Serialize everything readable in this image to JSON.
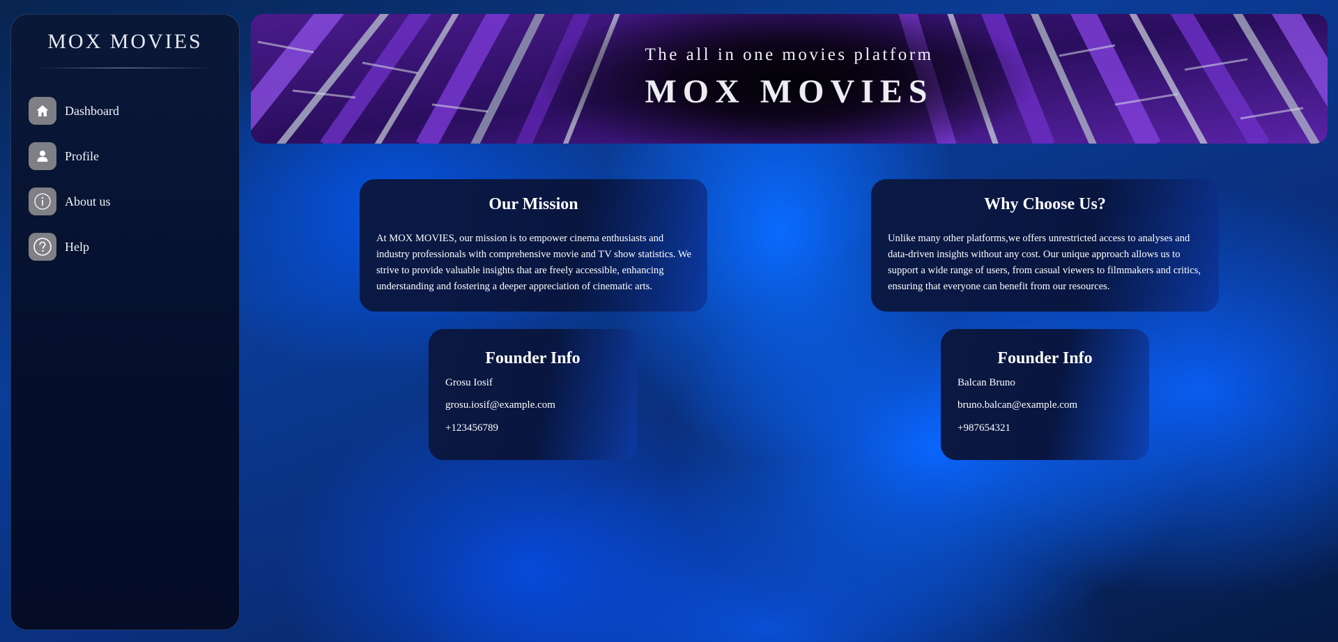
{
  "sidebar": {
    "brand": "MOX MOVIES",
    "items": [
      {
        "label": "Dashboard",
        "icon": "home-icon"
      },
      {
        "label": "Profile",
        "icon": "user-icon"
      },
      {
        "label": "About us",
        "icon": "info-icon"
      },
      {
        "label": "Help",
        "icon": "help-icon"
      }
    ]
  },
  "banner": {
    "subtitle": "The all in one movies platform",
    "title": "MOX MOVIES"
  },
  "mission": {
    "title": "Our Mission",
    "text": "At MOX MOVIES, our mission is to empower cinema enthusiasts and industry professionals with comprehensive movie and TV show statistics. We strive to provide valuable insights that are freely accessible, enhancing understanding and fostering a deeper appreciation of cinematic arts."
  },
  "why": {
    "title": "Why Choose Us?",
    "text": "Unlike many other platforms,we offers unrestricted access to analyses and data-driven insights without any cost. Our unique approach allows us to support a wide range of users, from casual viewers to filmmakers and critics, ensuring that everyone can benefit from our resources."
  },
  "founders": [
    {
      "title": "Founder Info",
      "name": "Grosu Iosif",
      "email": "grosu.iosif@example.com",
      "phone": "+123456789"
    },
    {
      "title": "Founder Info",
      "name": "Balcan Bruno",
      "email": "bruno.balcan@example.com",
      "phone": "+987654321"
    }
  ],
  "colors": {
    "icon_bg": "#7f7f86",
    "sidebar_bg": "#050f2c",
    "page_accent": "#0a66ff"
  }
}
